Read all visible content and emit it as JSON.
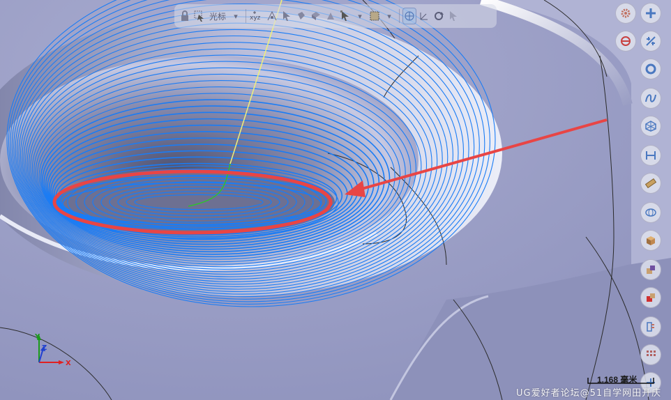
{
  "toolbar": {
    "snap_label": "光标",
    "items": [
      {
        "icon": "lock-icon"
      },
      {
        "icon": "cursor-select-icon"
      },
      {
        "icon": "xyz-coordinate-icon"
      },
      {
        "icon": "snap-point-icon"
      },
      {
        "icon": "arrow-select-icon"
      },
      {
        "icon": "filter-icon"
      },
      {
        "icon": "view-triad-icon"
      },
      {
        "icon": "rotate-view-icon"
      }
    ]
  },
  "right_bar": {
    "items": [
      "settings-gear-icon",
      "add-plus-icon",
      "no-entry-icon",
      "constraint-icon",
      "circle-icon",
      "curve-icon",
      "cube-wireframe-icon",
      "dimension-icon",
      "ruler-icon",
      "sphere-icon",
      "box-shade-icon",
      "color-swatch-purple-icon",
      "color-swatch-red-icon",
      "layers-icon",
      "grid-dots-icon"
    ]
  },
  "scale": {
    "value": "1.168 毫米"
  },
  "watermark": {
    "text": "UG爱好者论坛@51自学网田开庆"
  },
  "triad": {
    "x_label": "X",
    "y_label": "Y",
    "z_label": "Z"
  },
  "colors": {
    "toolpath": "#1a7cf5",
    "annotation": "#e84545",
    "background": "#9da1c6",
    "tool_axis": "#f0f07a",
    "triad_x": "#e02020",
    "triad_y": "#1a9a1a",
    "triad_z": "#2040d0"
  }
}
